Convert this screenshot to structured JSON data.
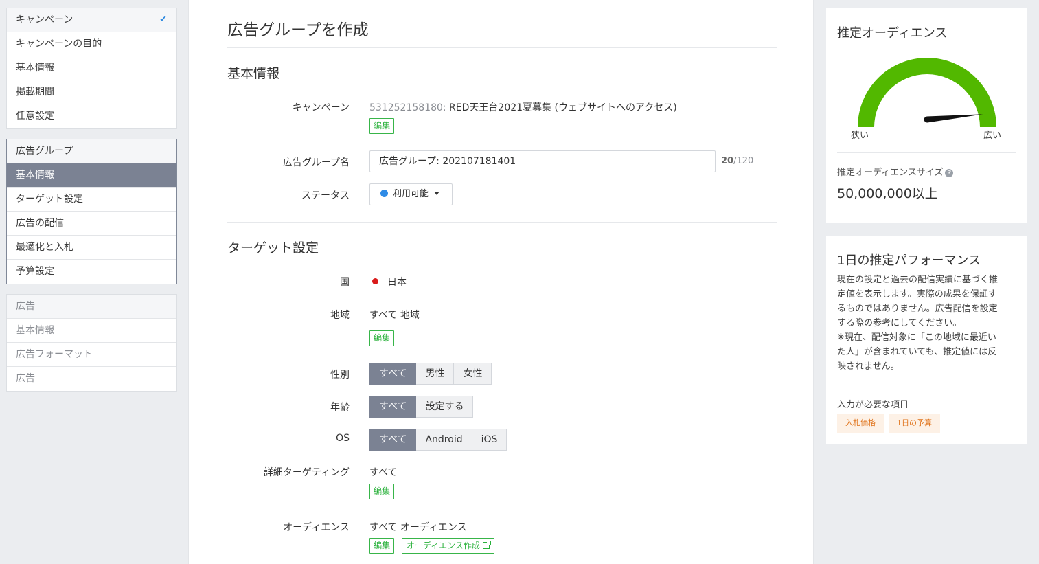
{
  "nav": {
    "campaign_group": [
      {
        "label": "キャンペーン",
        "done": true
      },
      {
        "label": "キャンペーンの目的"
      },
      {
        "label": "基本情報"
      },
      {
        "label": "掲載期間"
      },
      {
        "label": "任意設定"
      }
    ],
    "adgroup_group": [
      {
        "label": "広告グループ"
      },
      {
        "label": "基本情報"
      },
      {
        "label": "ターゲット設定"
      },
      {
        "label": "広告の配信"
      },
      {
        "label": "最適化と入札"
      },
      {
        "label": "予算設定"
      }
    ],
    "ad_group": [
      {
        "label": "広告"
      },
      {
        "label": "基本情報"
      },
      {
        "label": "広告フォーマット"
      },
      {
        "label": "広告"
      }
    ]
  },
  "main": {
    "title": "広告グループを作成",
    "basic": {
      "title": "基本情報",
      "campaign_label": "キャンペーン",
      "campaign_id": "531252158180:",
      "campaign_name": " RED天王台2021夏募集 (ウェブサイトへのアクセス)",
      "edit": "編集",
      "name_label": "広告グループ名",
      "name_value": "広告グループ: 202107181401",
      "name_count": "20",
      "name_max": "/120",
      "status_label": "ステータス",
      "status_value": "利用可能"
    },
    "target": {
      "title": "ターゲット設定",
      "country_label": "国",
      "country_value": "日本",
      "region_label": "地域",
      "region_value": "すべて 地域",
      "edit": "編集",
      "gender_label": "性別",
      "gender_options": [
        "すべて",
        "男性",
        "女性"
      ],
      "age_label": "年齢",
      "age_options": [
        "すべて",
        "設定する"
      ],
      "os_label": "OS",
      "os_options": [
        "すべて",
        "Android",
        "iOS"
      ],
      "detail_label": "詳細ターゲティング",
      "detail_value": "すべて",
      "audience_label": "オーディエンス",
      "audience_value": "すべて オーディエンス",
      "audience_create": "オーディエンス作成"
    }
  },
  "audience_panel": {
    "title": "推定オーディエンス",
    "narrow": "狭い",
    "wide": "広い",
    "size_label": "推定オーディエンスサイズ",
    "size_value": "50,000,000以上",
    "gauge_level": 0.97,
    "gauge_color": "#52b800"
  },
  "performance_panel": {
    "title": "1日の推定パフォーマンス",
    "description": [
      "現在の設定と過去の配信実績に基づく推",
      "定値を表示します。実際の成果を保証す",
      "るものではありません。広告配信を設定",
      "する際の参考にしてください。",
      "※現在、配信対象に「この地域に最近い",
      "た人」が含まれていても、推定値には反",
      "映されません。"
    ],
    "required_label": "入力が必要な項目",
    "required_items": [
      "入札価格",
      "1日の予算"
    ]
  }
}
